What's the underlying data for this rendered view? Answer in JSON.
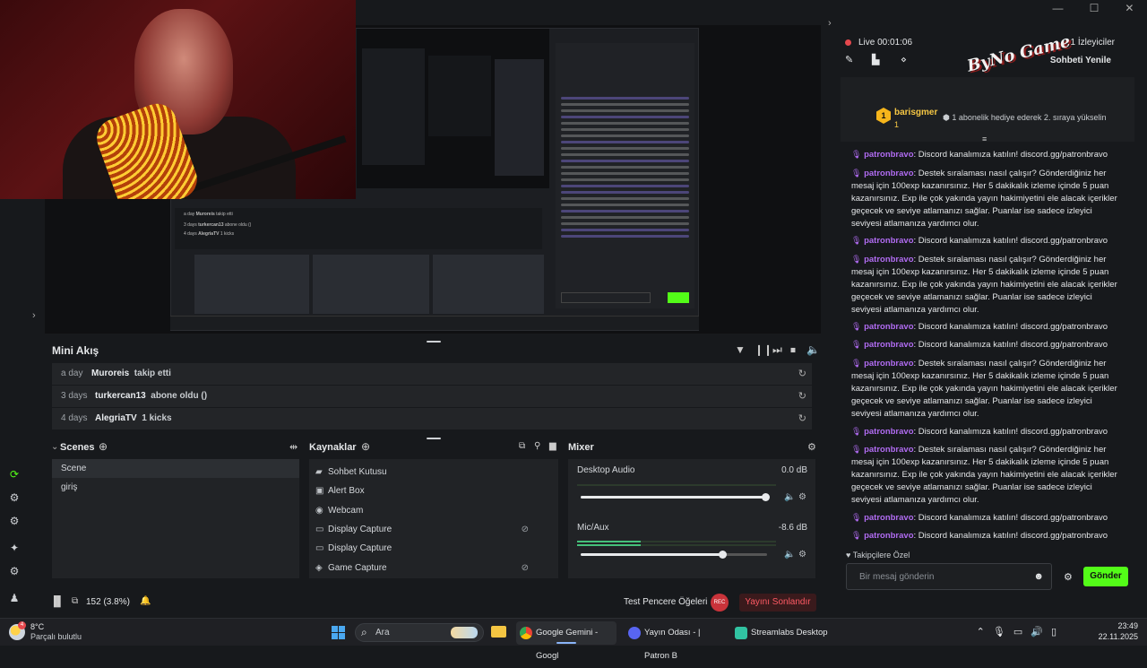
{
  "window": {
    "minimize": "—",
    "maximize": "☐",
    "close": "✕"
  },
  "preview": {
    "nested_feed": [
      {
        "when": "a day",
        "who": "Muroreis",
        "what": "takip etti"
      },
      {
        "when": "3 days",
        "who": "turkercan13",
        "what": "abone oldu ()"
      },
      {
        "when": "4 days",
        "who": "AlegriaTV",
        "what": "1 kicks"
      }
    ]
  },
  "mini_feed": {
    "title": "Mini Akış",
    "rows": [
      {
        "when": "a day",
        "who": "Muroreis",
        "what": "takip etti"
      },
      {
        "when": "3 days",
        "who": "turkercan13",
        "what": "abone oldu ()"
      },
      {
        "when": "4 days",
        "who": "AlegriaTV",
        "what": "1 kicks"
      }
    ]
  },
  "scenes": {
    "title": "Scenes",
    "items": [
      "Scene",
      "giriş"
    ],
    "selected": "Scene"
  },
  "sources": {
    "title": "Kaynaklar",
    "items": [
      {
        "label": "Sohbet Kutusu",
        "icon": "chat-icon"
      },
      {
        "label": "Alert Box",
        "icon": "alert-icon"
      },
      {
        "label": "Webcam",
        "icon": "webcam-icon"
      },
      {
        "label": "Display Capture",
        "icon": "monitor-icon",
        "hidden": true
      },
      {
        "label": "Display Capture",
        "icon": "monitor-icon"
      },
      {
        "label": "Game Capture",
        "icon": "gamepad-icon",
        "hidden": true
      }
    ]
  },
  "mixer": {
    "title": "Mixer",
    "channels": [
      {
        "label": "Desktop Audio",
        "db": "0.0 dB",
        "volume": 1.0,
        "level": 0.0
      },
      {
        "label": "Mic/Aux",
        "db": "-8.6 dB",
        "volume": 0.75,
        "level": 0.3
      }
    ]
  },
  "status": {
    "cpu": "152 (3.8%)",
    "test_label": "Test Pencere Öğeleri",
    "rec": "REC",
    "end_stream": "Yayını Sonlandır"
  },
  "chat": {
    "live": "Live 00:01:06",
    "viewers": "1 İzleyiciler",
    "refresh": "Sohbeti Yenile",
    "logo": "ByNo Game",
    "pinned": {
      "badge": "1",
      "user": "barisgmer",
      "level": "1",
      "gift": "1 abonelik hediye ederek 2. sıraya yükselin"
    },
    "messages": [
      {
        "user": "patronbravo",
        "text": ": Discord kanalımıza katılın! discord.gg/patronbravo"
      },
      {
        "user": "patronbravo",
        "text": ": Destek sıralaması nasıl çalışır? Gönderdiğiniz her mesaj için 100exp kazanırsınız. Her 5 dakikalık izleme içinde 5 puan kazanırsınız. Exp ile çok yakında yayın hakimiyetini ele alacak içerikler geçecek ve seviye atlamanızı sağlar. Puanlar ise sadece izleyici seviyesi atlamanıza yardımcı olur."
      },
      {
        "user": "patronbravo",
        "text": ": Discord kanalımıza katılın! discord.gg/patronbravo"
      },
      {
        "user": "patronbravo",
        "text": ": Destek sıralaması nasıl çalışır? Gönderdiğiniz her mesaj için 100exp kazanırsınız. Her 5 dakikalık izleme içinde 5 puan kazanırsınız. Exp ile çok yakında yayın hakimiyetini ele alacak içerikler geçecek ve seviye atlamanızı sağlar. Puanlar ise sadece izleyici seviyesi atlamanıza yardımcı olur."
      },
      {
        "user": "patronbravo",
        "text": ": Discord kanalımıza katılın! discord.gg/patronbravo"
      },
      {
        "user": "patronbravo",
        "text": ": Discord kanalımıza katılın! discord.gg/patronbravo"
      },
      {
        "user": "patronbravo",
        "text": ": Destek sıralaması nasıl çalışır? Gönderdiğiniz her mesaj için 100exp kazanırsınız. Her 5 dakikalık izleme içinde 5 puan kazanırsınız. Exp ile çok yakında yayın hakimiyetini ele alacak içerikler geçecek ve seviye atlamanızı sağlar. Puanlar ise sadece izleyici seviyesi atlamanıza yardımcı olur."
      },
      {
        "user": "patronbravo",
        "text": ": Discord kanalımıza katılın! discord.gg/patronbravo"
      },
      {
        "user": "patronbravo",
        "text": ": Destek sıralaması nasıl çalışır? Gönderdiğiniz her mesaj için 100exp kazanırsınız. Her 5 dakikalık izleme içinde 5 puan kazanırsınız. Exp ile çok yakında yayın hakimiyetini ele alacak içerikler geçecek ve seviye atlamanızı sağlar. Puanlar ise sadece izleyici seviyesi atlamanıza yardımcı olur."
      },
      {
        "user": "patronbravo",
        "text": ": Discord kanalımıza katılın! discord.gg/patronbravo"
      },
      {
        "user": "patronbravo",
        "text": ": Discord kanalımıza katılın! discord.gg/patronbravo"
      }
    ],
    "follower_only": "Takipçilere Özel",
    "input_placeholder": "Bir mesaj gönderin",
    "send": "Gönder",
    "send_color": "#53fc18"
  },
  "taskbar": {
    "temp": "8°C",
    "weather": "Parçalı bulutlu",
    "weather_badge": "4",
    "search": "Ara",
    "apps": [
      {
        "label": "Google Gemini - Googl",
        "icon": "chrome-icon",
        "active": true
      },
      {
        "label": "Yayın Odası - | Patron B",
        "icon": "discord-icon",
        "active": false,
        "badge": "1"
      },
      {
        "label": "Streamlabs Desktop",
        "icon": "streamlabs-icon",
        "active": false
      }
    ],
    "time": "23:49",
    "date": "22.11.2025"
  }
}
